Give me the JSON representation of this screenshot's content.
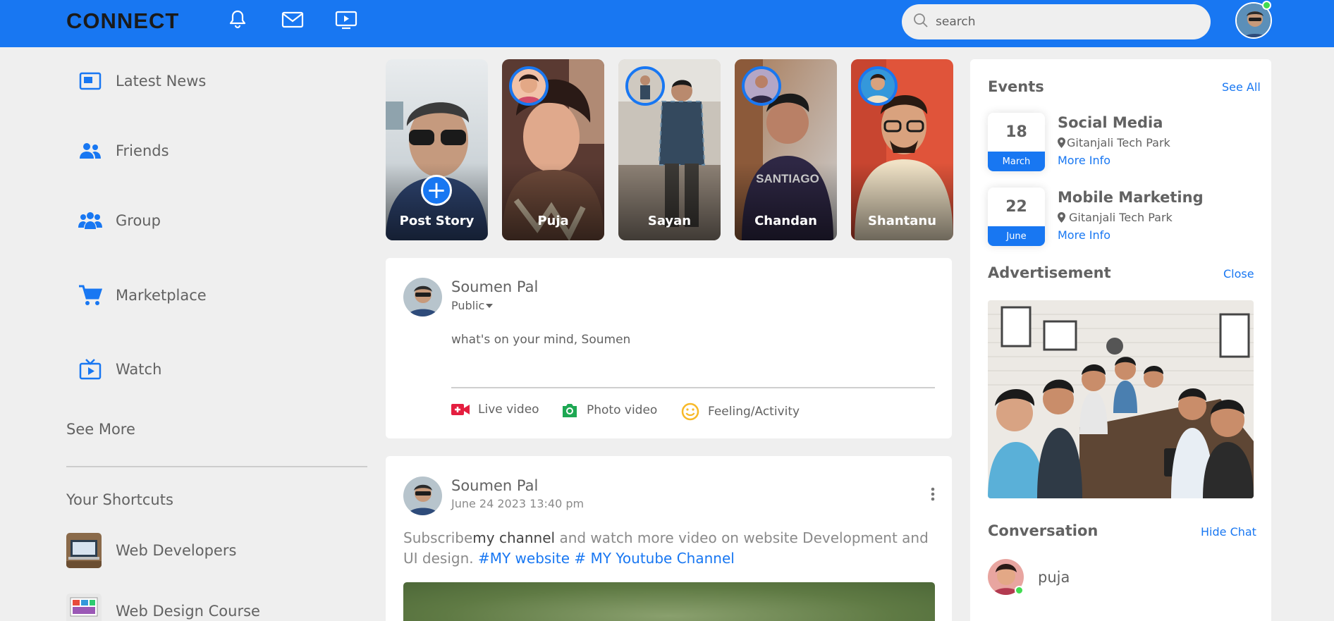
{
  "brand": {
    "logo": "CONNECT"
  },
  "header": {
    "icons": [
      "bell-icon",
      "mail-icon",
      "video-icon"
    ],
    "search_placeholder": "search"
  },
  "sidebar": {
    "items": [
      {
        "label": "Latest News",
        "icon": "news-icon"
      },
      {
        "label": "Friends",
        "icon": "friends-icon"
      },
      {
        "label": "Group",
        "icon": "group-icon"
      },
      {
        "label": "Marketplace",
        "icon": "cart-icon"
      },
      {
        "label": "Watch",
        "icon": "tv-icon"
      }
    ],
    "see_more": "See More",
    "shortcuts_title": "Your Shortcuts",
    "shortcuts": [
      {
        "label": "Web Developers"
      },
      {
        "label": "Web Design Course"
      }
    ]
  },
  "stories": [
    {
      "name": "Post Story"
    },
    {
      "name": "Puja"
    },
    {
      "name": "Sayan"
    },
    {
      "name": "Chandan"
    },
    {
      "name": "Shantanu"
    }
  ],
  "composer": {
    "user_name": "Soumen Pal",
    "privacy": "Public",
    "placeholder": "what's on your mind, Soumen",
    "actions": [
      {
        "label": "Live video",
        "color": "#e41e3f"
      },
      {
        "label": "Photo video",
        "color": "#1ea853"
      },
      {
        "label": "Feeling/Activity",
        "color": "#f7b928"
      }
    ]
  },
  "post": {
    "user_name": "Soumen Pal",
    "timestamp": "June 24 2023 13:40 pm",
    "text_prefix": "Subscribe",
    "text_highlight": "my channel",
    "text_body": " and watch more video on website Development and UI design. ",
    "link_1": "#MY website",
    "link_2": " # MY Youtube Channel"
  },
  "events": {
    "title": "Events",
    "see_all": "See All",
    "items": [
      {
        "day": "18",
        "month": "March",
        "title": "Social Media",
        "location": "Gitanjali Tech Park",
        "more": "More Info"
      },
      {
        "day": "22",
        "month": "June",
        "title": "Mobile Marketing",
        "location": "Gitanjali Tech Park",
        "more": "More Info"
      }
    ]
  },
  "advertisement": {
    "title": "Advertisement",
    "close": "Close"
  },
  "conversation": {
    "title": "Conversation",
    "hide": "Hide Chat",
    "contacts": [
      {
        "name": "puja",
        "online": true
      }
    ]
  },
  "colors": {
    "primary": "#1877f2",
    "background": "#efefef",
    "text": "#626262",
    "online": "#41db51"
  }
}
